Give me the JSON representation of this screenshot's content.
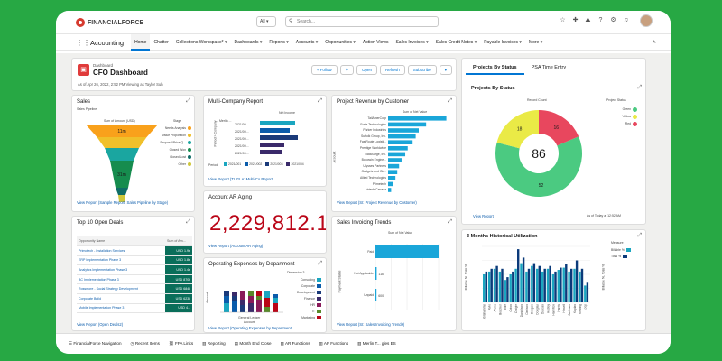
{
  "topbar": {
    "logo": "FINANCIALFORCE",
    "scope": "All",
    "search_placeholder": "Search..."
  },
  "nav": {
    "app_name": "Accounting",
    "items": [
      "Home",
      "Chatter",
      "Collections Workspace*",
      "Dashboards",
      "Reports",
      "Accounts",
      "Opportunities",
      "Action Views",
      "Sales Invoices",
      "Sales Credit Notes",
      "Payable Invoices",
      "More"
    ]
  },
  "dashboard": {
    "label": "Dashboard",
    "title": "CFO Dashboard",
    "subtitle": "As of Apr 26, 2022, 2:52 PM Viewing as Taylor Suh",
    "buttons": {
      "follow": "+ Follow",
      "open": "Open",
      "refresh": "Refresh",
      "subscribe": "Subscribe"
    }
  },
  "sales": {
    "title": "Sales",
    "subtitle": "Sales Pipeline",
    "axis_label": "Sum of Amount (USD)",
    "stage_label": "Stage",
    "stages": [
      "Needs Analysis",
      "Value Proposition",
      "Proposal/Price Q...",
      "Closed Won",
      "Closed Lost",
      "Other"
    ],
    "funnel_labels": [
      "11m",
      "31m"
    ],
    "link": "View Report (Sample Report: Sales Pipeline by Stage)",
    "chart_data": {
      "type": "funnel",
      "categories": [
        "Needs Analysis",
        "Value Proposition",
        "Proposal/Price Q...",
        "Closed Won",
        "Closed Lost",
        "Other"
      ],
      "labels": [
        "11m",
        "",
        "",
        "31m",
        "",
        ""
      ],
      "colors": [
        "#f9a11b",
        "#f0c02a",
        "#1aa6a0",
        "#168c4e",
        "#0f6d67",
        "#cfc73a"
      ]
    }
  },
  "multico": {
    "title": "Multi-Company Report",
    "col_header": "Net Income",
    "row_header": "Period > Company",
    "company": "Merlin ...",
    "rows": [
      "2021/00...",
      "2021/00...",
      "2021/00...",
      "2021/00...",
      "2021/00..."
    ],
    "legend_label": "Period",
    "legend": [
      "2021/001",
      "2021/002",
      "2021/003",
      "2021/004"
    ],
    "link": "View Report (TUGLA: Multi-Co Report)",
    "chart_data": {
      "type": "bar",
      "orientation": "horizontal",
      "categories": [
        "2021/00...",
        "2021/00...",
        "2021/00...",
        "2021/00...",
        "2021/00..."
      ],
      "series": [
        {
          "name": "2021/001",
          "color": "#1aa6c0",
          "values": [
            0.65,
            0,
            0,
            0,
            0
          ]
        },
        {
          "name": "2021/002",
          "color": "#0b5cab",
          "values": [
            0,
            0.55,
            0,
            0,
            0
          ]
        },
        {
          "name": "2021/003",
          "color": "#1a3a7a",
          "values": [
            0,
            0,
            0.7,
            0,
            0
          ]
        },
        {
          "name": "2021/004",
          "color": "#3a2a6a",
          "values": [
            0,
            0,
            0,
            0.45,
            0.4
          ]
        }
      ]
    }
  },
  "revenue": {
    "title": "Project Revenue by Customer",
    "axis_label": "Sum of Net Value",
    "account_label": "Account",
    "customers": [
      "TailAmerCorp",
      "Forte Technologies",
      "Parker Industries",
      "Suffolk Group, Inc.",
      "FastRoute Logisti...",
      "Prestige Worldwide",
      "DataSurge, Inc.",
      "Bonowin Engine...",
      "Ulysses Partners",
      "Gadgets and Gir...",
      "Allied Technologies",
      "Primetech",
      "Airtech Canada"
    ],
    "link": "View Report (SI: Project Revenue by Customer)",
    "chart_data": {
      "type": "bar",
      "orientation": "horizontal",
      "categories": [
        "TailAmerCorp",
        "Forte Technologies",
        "Parker Industries",
        "Suffolk Group, Inc.",
        "FastRoute Logisti...",
        "Prestige Worldwide",
        "DataSurge, Inc.",
        "Bonowin Engine...",
        "Ulysses Partners",
        "Gadgets and Gir...",
        "Allied Technologies",
        "Primetech",
        "Airtech Canada"
      ],
      "values": [
        0.95,
        0.62,
        0.5,
        0.45,
        0.4,
        0.32,
        0.28,
        0.22,
        0.18,
        0.15,
        0.12,
        0.08,
        0.05
      ],
      "color": "#1aa6d9"
    }
  },
  "status_tabs": [
    "Projects By Status",
    "PSA Time Entry"
  ],
  "status": {
    "title": "Projects By Status",
    "count_label": "Record Count",
    "status_label": "Project Status",
    "center": "86",
    "legend": [
      "Green",
      "Yellow",
      "Red"
    ],
    "slice_labels": [
      "52",
      "18",
      "16"
    ],
    "link": "View Report",
    "asof": "As of Today at 12:52 AM",
    "chart_data": {
      "type": "pie",
      "categories": [
        "Green",
        "Yellow",
        "Red"
      ],
      "values": [
        52,
        18,
        16
      ],
      "colors": [
        "#4bca81",
        "#eaea46",
        "#e8475e"
      ]
    }
  },
  "ar": {
    "title": "Account AR Aging",
    "value": "2,229,812.1",
    "link": "View Report (Account AR Aging)"
  },
  "deals": {
    "title": "Top 10 Open Deals",
    "headers": [
      "Opportunity Name",
      "Sum of Am..."
    ],
    "rows": [
      {
        "name": "Primotech - Installation Services",
        "amt": "USD 1.9e"
      },
      {
        "name": "ERP Implementation Phase 3",
        "amt": "USD 1.8e"
      },
      {
        "name": "Analytics Implementation Phase 3",
        "amt": "USD 1.4e"
      },
      {
        "name": "BC Implementation Phase 3",
        "amt": "USD 870k"
      },
      {
        "name": "Rossmore - Social Strategy Development",
        "amt": "USD 684k"
      },
      {
        "name": "Corporate Build",
        "amt": "USD 623k"
      },
      {
        "name": "Mobile Implementation Phase 3",
        "amt": "USD 4..."
      }
    ],
    "link": "View Report (Open Deals2)"
  },
  "opex": {
    "title": "Operating Expenses by Department",
    "dim_label": "Dimension 3",
    "ledger_label": "General Ledger",
    "account_label": "Account",
    "amount_label": "Amount",
    "depts": [
      "Consulting",
      "Corporate",
      "Development",
      "Finance",
      "HR",
      "IT",
      "Marketing"
    ],
    "link": "View Report (Operating Expenses by Department)",
    "chart_data": {
      "type": "bar",
      "stacked": true,
      "categories": [
        "c1",
        "c2",
        "c3",
        "c4",
        "c5",
        "c6",
        "c7"
      ],
      "colors": [
        "#1aa6c0",
        "#0b5cab",
        "#1a3a7a",
        "#3a2a6a",
        "#8a1a5a",
        "#5a8a2a",
        "#ba0517"
      ]
    }
  },
  "invtrend": {
    "title": "Sales Invoicing Trends",
    "axis_label": "Sum of Net Value",
    "status_label": "Payment Status",
    "categories": [
      "Paid",
      "Not Applicable",
      "Unpaid"
    ],
    "labels": [
      "",
      "11k",
      "600"
    ],
    "link": "View Report (SI: Sales Invoicing Trends)",
    "chart_data": {
      "type": "bar",
      "orientation": "horizontal",
      "categories": [
        "Paid",
        "Not Applicable",
        "Unpaid"
      ],
      "values": [
        1.0,
        0.02,
        0.01
      ],
      "color": "#1aa6d9"
    }
  },
  "util": {
    "title": "3 Months Historical Utilization",
    "measure_label": "Measure",
    "legend": [
      "Billable %",
      "Total %"
    ],
    "y1_label": "Billable %, Total %",
    "y2_label": "Billable %, Total %",
    "chart_data": {
      "type": "bar",
      "categories": [
        "Abrahamms",
        "Alvie",
        "Aruna",
        "Beacher",
        "Bolle",
        "Coton",
        "Craigie",
        "Danielson",
        "Davison",
        "Doogan",
        "Douglas",
        "Duncan",
        "Hadley",
        "Hamilton",
        "Harris",
        "Howell",
        "Jackman",
        "Kaplan",
        "Keating",
        "Loop"
      ],
      "series": [
        {
          "name": "Billable %",
          "color": "#1aa6c0",
          "values": [
            0.5,
            0.55,
            0.6,
            0.55,
            0.4,
            0.5,
            0.6,
            0.7,
            0.55,
            0.65,
            0.6,
            0.55,
            0.6,
            0.5,
            0.58,
            0.62,
            0.55,
            0.6,
            0.55,
            0.3
          ]
        },
        {
          "name": "Total %",
          "color": "#0b3a7a",
          "values": [
            0.55,
            0.6,
            0.65,
            0.6,
            0.45,
            0.55,
            0.95,
            0.8,
            0.6,
            0.7,
            0.65,
            0.6,
            0.65,
            0.55,
            0.62,
            0.68,
            0.6,
            0.75,
            0.6,
            0.35
          ]
        }
      ]
    }
  },
  "bottombar": [
    "FinancialForce Navigation",
    "Recent Items",
    "FFA Links",
    "Reporting",
    "Month End Close",
    "AR Functions",
    "AP Functions",
    "Merlin T... gles ES"
  ]
}
